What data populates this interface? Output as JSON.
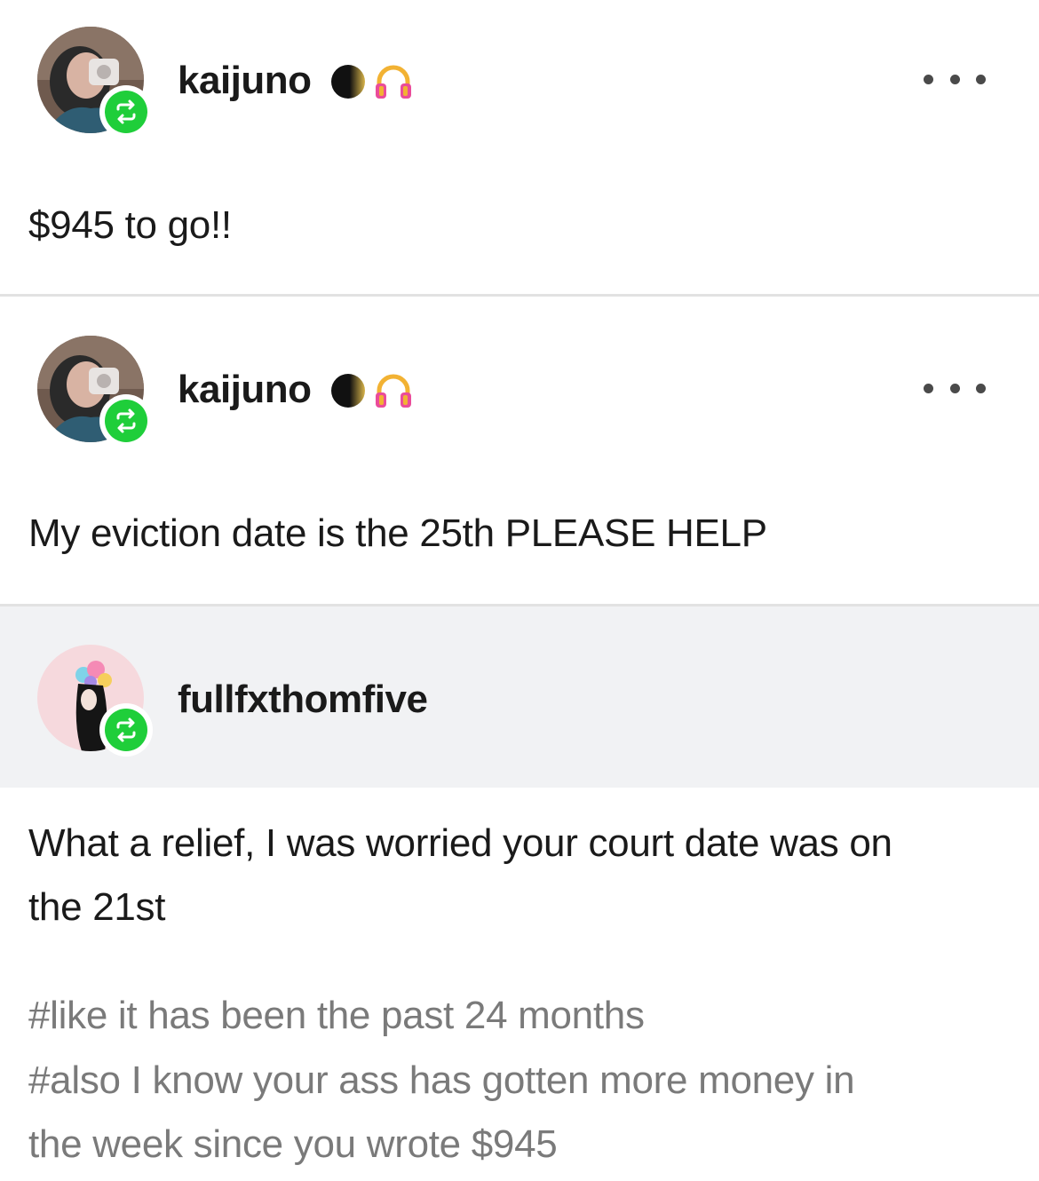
{
  "posts": [
    {
      "username": "kaijuno",
      "body": "$945 to go!!",
      "badges": [
        "black-moon-badge",
        "headphones-badge"
      ]
    },
    {
      "username": "kaijuno",
      "body": "My eviction date is the 25th PLEASE HELP",
      "badges": [
        "black-moon-badge",
        "headphones-badge"
      ]
    },
    {
      "username": "fullfxthomfive",
      "body_line1": "What a relief, I was worried your court date was on",
      "body_line2": "the 21st",
      "tags": [
        "#like it has been the past 24 months",
        "#also I know your ass has gotten more money in",
        "the week since you wrote $945"
      ]
    }
  ],
  "colors": {
    "reblog_green": "#1fce3a",
    "tag_gray": "#7a7a7a",
    "header_gray_bg": "#f1f2f4",
    "divider": "#e2e2e2"
  },
  "icons": {
    "reblog": "reblog-icon",
    "more": "more-options-icon"
  }
}
